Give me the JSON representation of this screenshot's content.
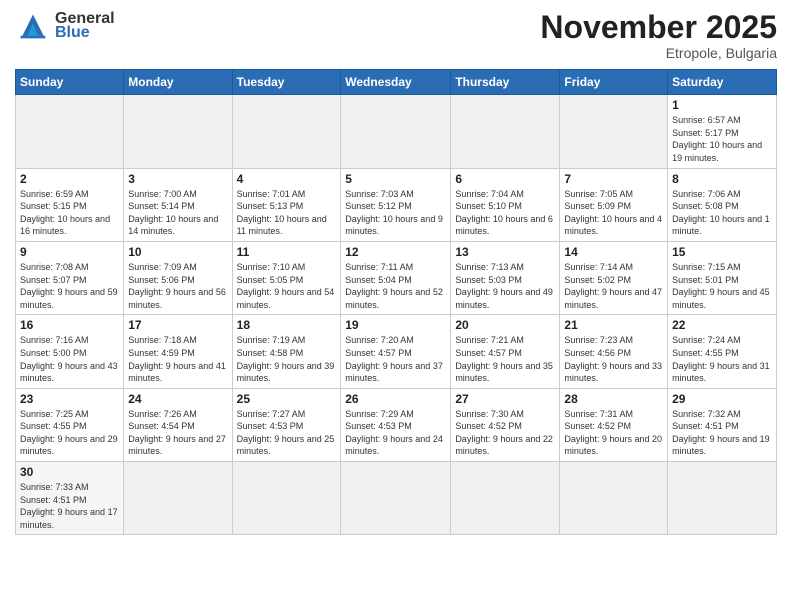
{
  "header": {
    "logo": {
      "general": "General",
      "blue": "Blue"
    },
    "month": "November 2025",
    "location": "Etropole, Bulgaria"
  },
  "weekdays": [
    "Sunday",
    "Monday",
    "Tuesday",
    "Wednesday",
    "Thursday",
    "Friday",
    "Saturday"
  ],
  "days": {
    "1": {
      "sunrise": "6:57 AM",
      "sunset": "5:17 PM",
      "daylight": "10 hours and 19 minutes."
    },
    "2": {
      "sunrise": "6:59 AM",
      "sunset": "5:15 PM",
      "daylight": "10 hours and 16 minutes."
    },
    "3": {
      "sunrise": "7:00 AM",
      "sunset": "5:14 PM",
      "daylight": "10 hours and 14 minutes."
    },
    "4": {
      "sunrise": "7:01 AM",
      "sunset": "5:13 PM",
      "daylight": "10 hours and 11 minutes."
    },
    "5": {
      "sunrise": "7:03 AM",
      "sunset": "5:12 PM",
      "daylight": "10 hours and 9 minutes."
    },
    "6": {
      "sunrise": "7:04 AM",
      "sunset": "5:10 PM",
      "daylight": "10 hours and 6 minutes."
    },
    "7": {
      "sunrise": "7:05 AM",
      "sunset": "5:09 PM",
      "daylight": "10 hours and 4 minutes."
    },
    "8": {
      "sunrise": "7:06 AM",
      "sunset": "5:08 PM",
      "daylight": "10 hours and 1 minute."
    },
    "9": {
      "sunrise": "7:08 AM",
      "sunset": "5:07 PM",
      "daylight": "9 hours and 59 minutes."
    },
    "10": {
      "sunrise": "7:09 AM",
      "sunset": "5:06 PM",
      "daylight": "9 hours and 56 minutes."
    },
    "11": {
      "sunrise": "7:10 AM",
      "sunset": "5:05 PM",
      "daylight": "9 hours and 54 minutes."
    },
    "12": {
      "sunrise": "7:11 AM",
      "sunset": "5:04 PM",
      "daylight": "9 hours and 52 minutes."
    },
    "13": {
      "sunrise": "7:13 AM",
      "sunset": "5:03 PM",
      "daylight": "9 hours and 49 minutes."
    },
    "14": {
      "sunrise": "7:14 AM",
      "sunset": "5:02 PM",
      "daylight": "9 hours and 47 minutes."
    },
    "15": {
      "sunrise": "7:15 AM",
      "sunset": "5:01 PM",
      "daylight": "9 hours and 45 minutes."
    },
    "16": {
      "sunrise": "7:16 AM",
      "sunset": "5:00 PM",
      "daylight": "9 hours and 43 minutes."
    },
    "17": {
      "sunrise": "7:18 AM",
      "sunset": "4:59 PM",
      "daylight": "9 hours and 41 minutes."
    },
    "18": {
      "sunrise": "7:19 AM",
      "sunset": "4:58 PM",
      "daylight": "9 hours and 39 minutes."
    },
    "19": {
      "sunrise": "7:20 AM",
      "sunset": "4:57 PM",
      "daylight": "9 hours and 37 minutes."
    },
    "20": {
      "sunrise": "7:21 AM",
      "sunset": "4:57 PM",
      "daylight": "9 hours and 35 minutes."
    },
    "21": {
      "sunrise": "7:23 AM",
      "sunset": "4:56 PM",
      "daylight": "9 hours and 33 minutes."
    },
    "22": {
      "sunrise": "7:24 AM",
      "sunset": "4:55 PM",
      "daylight": "9 hours and 31 minutes."
    },
    "23": {
      "sunrise": "7:25 AM",
      "sunset": "4:55 PM",
      "daylight": "9 hours and 29 minutes."
    },
    "24": {
      "sunrise": "7:26 AM",
      "sunset": "4:54 PM",
      "daylight": "9 hours and 27 minutes."
    },
    "25": {
      "sunrise": "7:27 AM",
      "sunset": "4:53 PM",
      "daylight": "9 hours and 25 minutes."
    },
    "26": {
      "sunrise": "7:29 AM",
      "sunset": "4:53 PM",
      "daylight": "9 hours and 24 minutes."
    },
    "27": {
      "sunrise": "7:30 AM",
      "sunset": "4:52 PM",
      "daylight": "9 hours and 22 minutes."
    },
    "28": {
      "sunrise": "7:31 AM",
      "sunset": "4:52 PM",
      "daylight": "9 hours and 20 minutes."
    },
    "29": {
      "sunrise": "7:32 AM",
      "sunset": "4:51 PM",
      "daylight": "9 hours and 19 minutes."
    },
    "30": {
      "sunrise": "7:33 AM",
      "sunset": "4:51 PM",
      "daylight": "9 hours and 17 minutes."
    }
  }
}
